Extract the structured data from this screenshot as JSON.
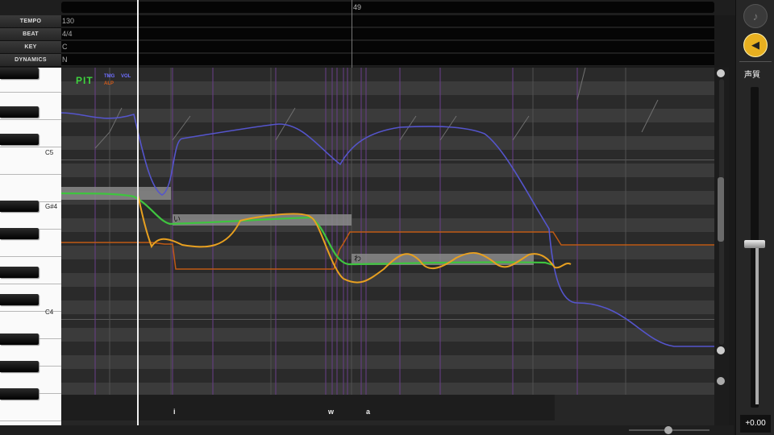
{
  "ruler": {
    "bar_number": "49"
  },
  "params": [
    {
      "label": "TEMPO",
      "value": "130"
    },
    {
      "label": "BEAT",
      "value": "4/4"
    },
    {
      "label": "KEY",
      "value": "C"
    },
    {
      "label": "DYNAMICS",
      "value": "N"
    }
  ],
  "piano": {
    "labels": [
      {
        "text": "C5"
      },
      {
        "text": "G#4"
      },
      {
        "text": "C4"
      }
    ]
  },
  "legend": {
    "pit": "PIT",
    "tmg": "TMG",
    "vol": "VOL",
    "alp": "ALP",
    "colors": {
      "pit": "#3fd43f",
      "tmg": "#6f6fff",
      "vol": "#6f6fff",
      "alp": "#d05a1a"
    }
  },
  "notes": [
    {
      "label": ""
    },
    {
      "label": "い"
    },
    {
      "label": "わ"
    }
  ],
  "lyrics": [
    "i",
    "w",
    "a"
  ],
  "right_panel": {
    "voice_label": "声質",
    "value": "+0.00",
    "note_icon": "music-note-icon",
    "speaker_icon": "speaker-icon",
    "accent": "#e8b020"
  }
}
